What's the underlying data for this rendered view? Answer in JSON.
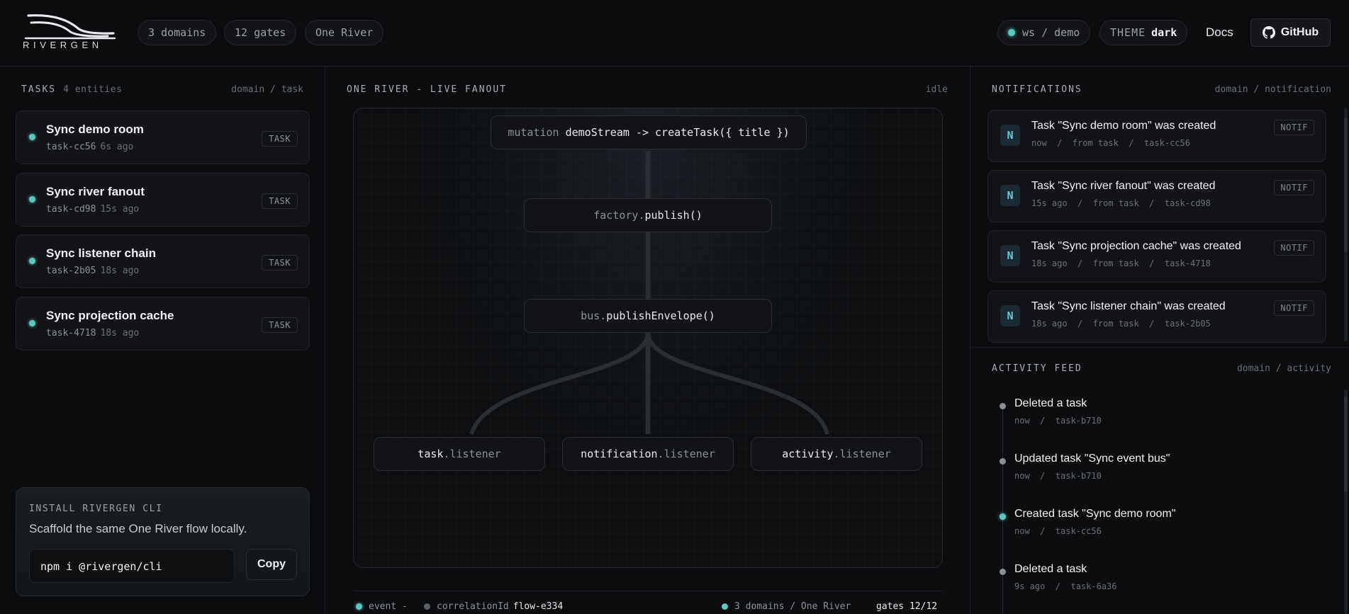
{
  "header": {
    "logo_text": "RIVERGEN",
    "pills": [
      "3 domains",
      "12 gates",
      "One River"
    ],
    "ws_label": "ws / demo",
    "theme_label": "THEME",
    "theme_value": "dark",
    "docs_label": "Docs",
    "github_label": "GitHub"
  },
  "tasks": {
    "title": "TASKS",
    "count": "4 entities",
    "route": "domain / task",
    "items": [
      {
        "title": "Sync demo room",
        "id": "task-cc56",
        "ago": "6s ago",
        "badge": "TASK"
      },
      {
        "title": "Sync river fanout",
        "id": "task-cd98",
        "ago": "15s ago",
        "badge": "TASK"
      },
      {
        "title": "Sync listener chain",
        "id": "task-2b05",
        "ago": "18s ago",
        "badge": "TASK"
      },
      {
        "title": "Sync projection cache",
        "id": "task-4718",
        "ago": "18s ago",
        "badge": "TASK"
      }
    ]
  },
  "install": {
    "title": "INSTALL RIVERGEN CLI",
    "description": "Scaffold the same One River flow locally.",
    "command": "npm i @rivergen/cli",
    "copy_label": "Copy"
  },
  "flow": {
    "title": "ONE RIVER - LIVE FANOUT",
    "status": "idle",
    "mutation_kw": "mutation",
    "mutation_call": "demoStream -> createTask({ title })",
    "publish_obj": "factory.",
    "publish_fn": "publish()",
    "bus_obj": "bus.",
    "bus_fn": "publishEnvelope()",
    "listeners": [
      {
        "domain": "task",
        "suffix": ".listener"
      },
      {
        "domain": "notification",
        "suffix": ".listener"
      },
      {
        "domain": "activity",
        "suffix": ".listener"
      }
    ],
    "footer": {
      "event_label": "event -",
      "correlation_label": "correlationId",
      "correlation_value": "flow-e334",
      "domains_label": "3 domains / One River",
      "gates_label": "gates 12/12"
    }
  },
  "notifications": {
    "title": "NOTIFICATIONS",
    "route": "domain / notification",
    "items": [
      {
        "icon": "N",
        "title": "Task \"Sync demo room\" was created",
        "sub": "now  /  from task  /  task-cc56",
        "badge": "NOTIF"
      },
      {
        "icon": "N",
        "title": "Task \"Sync river fanout\" was created",
        "sub": "15s ago  /  from task  /  task-cd98",
        "badge": "NOTIF"
      },
      {
        "icon": "N",
        "title": "Task \"Sync projection cache\" was created",
        "sub": "18s ago  /  from task  /  task-4718",
        "badge": "NOTIF"
      },
      {
        "icon": "N",
        "title": "Task \"Sync listener chain\" was created",
        "sub": "18s ago  /  from task  /  task-2b05",
        "badge": "NOTIF"
      }
    ]
  },
  "activity": {
    "title": "ACTIVITY FEED",
    "route": "domain / activity",
    "items": [
      {
        "title": "Deleted a task",
        "sub": "now  /  task-b710",
        "dot": "gray"
      },
      {
        "title": "Updated task \"Sync event bus\"",
        "sub": "now  /  task-b710",
        "dot": "gray"
      },
      {
        "title": "Created task \"Sync demo room\"",
        "sub": "now  /  task-cc56",
        "dot": "teal"
      },
      {
        "title": "Deleted a task",
        "sub": "9s ago  /  task-6a36",
        "dot": "gray"
      }
    ]
  },
  "colors": {
    "accent": "#5cc8c0",
    "background": "#0b0c0e",
    "card": "#121417"
  }
}
